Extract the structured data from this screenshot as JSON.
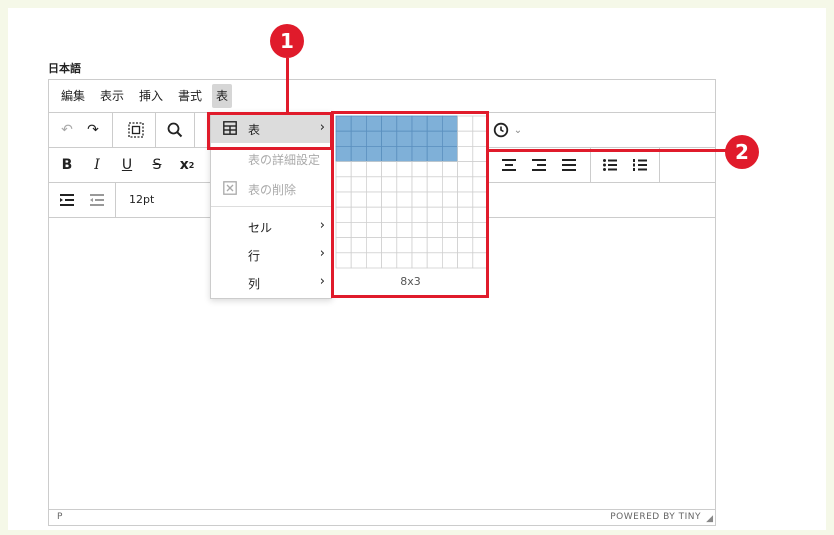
{
  "field": {
    "label": "日本語"
  },
  "menubar": [
    {
      "label": "編集"
    },
    {
      "label": "表示"
    },
    {
      "label": "挿入"
    },
    {
      "label": "書式"
    },
    {
      "label": "表"
    }
  ],
  "toolbar": {
    "font_size": "12pt"
  },
  "table_menu": [
    {
      "label": "表",
      "icon": "table-icon",
      "state": "highlighted"
    },
    {
      "label": "表の詳細設定",
      "state": "disabled"
    },
    {
      "label": "表の削除",
      "icon": "table-delete-icon",
      "state": "disabled"
    },
    {
      "label": "セル",
      "state": "normal"
    },
    {
      "label": "行",
      "state": "normal"
    },
    {
      "label": "列",
      "state": "normal"
    }
  ],
  "table_grid": {
    "columns": 10,
    "rows": 10,
    "selected_columns": 8,
    "selected_rows": 3,
    "size_label": "8x3",
    "highlight_color": "#7fb0d8"
  },
  "status": {
    "path": "P",
    "powered_by": "POWERED BY TINY"
  },
  "annotations": [
    {
      "number": "1"
    },
    {
      "number": "2"
    }
  ],
  "colors": {
    "accent": "#e01b2b"
  }
}
